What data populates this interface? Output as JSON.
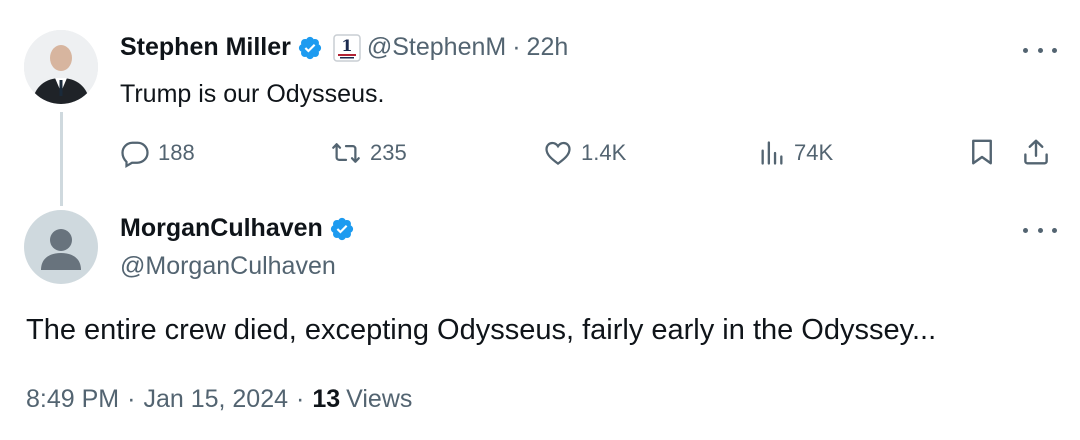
{
  "parent_tweet": {
    "author_name": "Stephen Miller",
    "handle": "@StephenM",
    "separator": "·",
    "time": "22h",
    "text": "Trump is our Odysseus.",
    "actions": {
      "replies": "188",
      "reposts": "235",
      "likes": "1.4K",
      "views": "74K"
    }
  },
  "reply_tweet": {
    "author_name": "MorganCulhaven",
    "handle": "@MorganCulhaven",
    "text": "The entire crew died, excepting Odysseus, fairly early in the Odyssey...",
    "time": "8:49 PM",
    "sep1": "·",
    "date": "Jan 15, 2024",
    "sep2": "·",
    "views_count": "13",
    "views_label": "Views"
  },
  "colors": {
    "verified": "#1d9bf0",
    "muted": "#536471",
    "thread_line": "#cfd9de"
  }
}
